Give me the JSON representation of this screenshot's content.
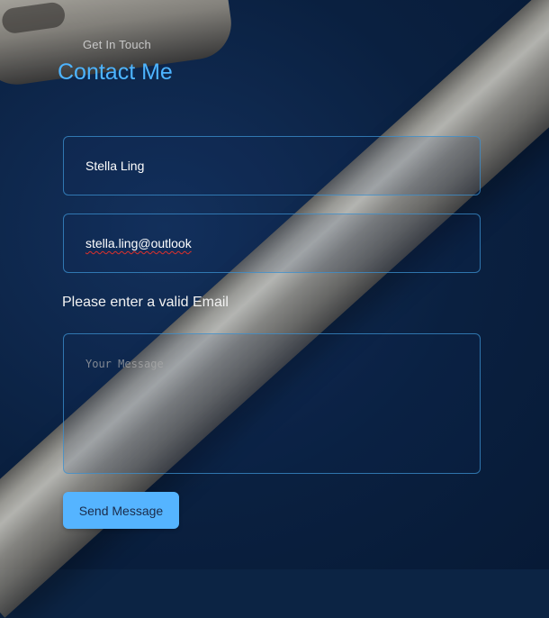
{
  "header": {
    "eyebrow": "Get In Touch",
    "title": "Contact Me"
  },
  "form": {
    "name_value": "Stella Ling",
    "email_value": "stella.ling@outlook",
    "email_error": "Please enter a valid Email",
    "message_placeholder": "Your Message",
    "send_label": "Send Message"
  },
  "colors": {
    "accent": "#4db4ff",
    "button": "#55b4ff",
    "field_border": "#3c91d2",
    "background": "#0c2444"
  }
}
